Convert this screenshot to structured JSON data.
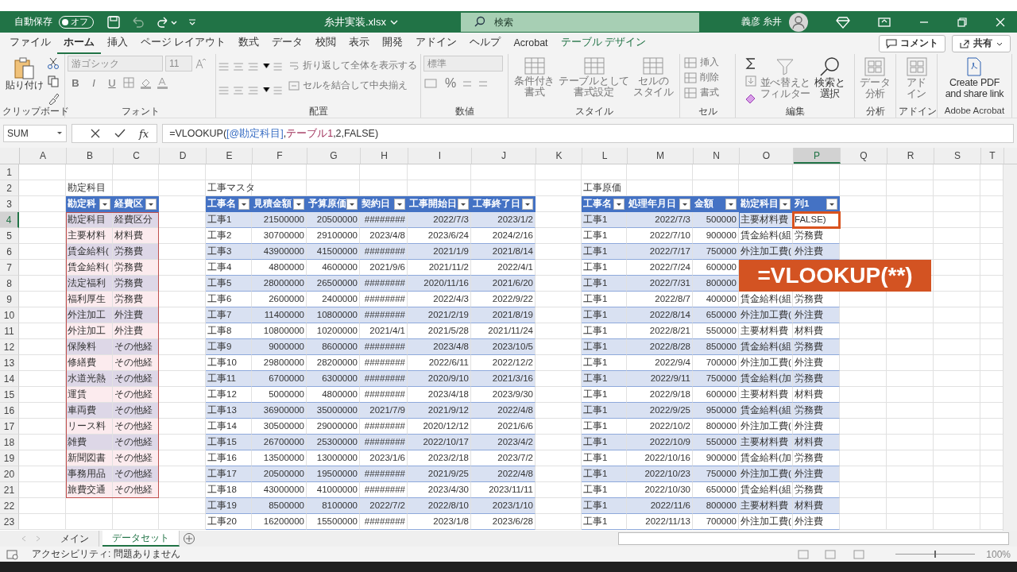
{
  "title_bar": {
    "autosave_label": "自動保存",
    "autosave_toggle": {
      "label": "オフ",
      "on": false
    },
    "filename": "糸井実装.xlsx",
    "search": {
      "placeholder": "検索"
    },
    "user": "義彦 糸井"
  },
  "menu_tabs": [
    {
      "label": "ファイル",
      "selected": false,
      "kind": "normal"
    },
    {
      "label": "ホーム",
      "selected": true,
      "kind": "normal"
    },
    {
      "label": "挿入",
      "selected": false,
      "kind": "normal"
    },
    {
      "label": "ページ レイアウト",
      "selected": false,
      "kind": "normal"
    },
    {
      "label": "数式",
      "selected": false,
      "kind": "normal"
    },
    {
      "label": "データ",
      "selected": false,
      "kind": "normal"
    },
    {
      "label": "校閲",
      "selected": false,
      "kind": "normal"
    },
    {
      "label": "表示",
      "selected": false,
      "kind": "normal"
    },
    {
      "label": "開発",
      "selected": false,
      "kind": "normal"
    },
    {
      "label": "アドイン",
      "selected": false,
      "kind": "normal"
    },
    {
      "label": "ヘルプ",
      "selected": false,
      "kind": "normal"
    },
    {
      "label": "Acrobat",
      "selected": false,
      "kind": "normal"
    },
    {
      "label": "テーブル デザイン",
      "selected": false,
      "kind": "contextual"
    }
  ],
  "header_buttons": [
    {
      "label": "コメント"
    },
    {
      "label": "共有"
    }
  ],
  "ribbon": {
    "groups": [
      {
        "label": "クリップボード",
        "paste": {
          "label": "貼り付け",
          "disabled": false
        }
      },
      {
        "label": "フォント",
        "font_name": {
          "value": "游ゴシック",
          "disabled": true
        },
        "font_size": {
          "value": "11",
          "disabled": true
        },
        "style_buttons": [
          {
            "label": "B",
            "disabled": true
          },
          {
            "label": "I",
            "disabled": true
          },
          {
            "label": "U",
            "disabled": true
          }
        ]
      },
      {
        "label": "配置",
        "wrap": {
          "label": "折り返して全体を表示する",
          "disabled": true
        },
        "merge": {
          "label": "セルを結合して中央揃え",
          "disabled": true
        }
      },
      {
        "label": "数値",
        "format": {
          "value": "標準",
          "disabled": true
        },
        "percent": {
          "label": "%",
          "disabled": true
        }
      },
      {
        "label": "スタイル",
        "buttons": [
          {
            "lines": [
              "条件付き",
              "書式"
            ],
            "disabled": true
          },
          {
            "lines": [
              "テーブルとして",
              "書式設定"
            ],
            "disabled": true
          },
          {
            "lines": [
              "セルの",
              "スタイル"
            ],
            "disabled": true
          }
        ]
      },
      {
        "label": "セル",
        "buttons": [
          {
            "label": "挿入",
            "disabled": true
          },
          {
            "label": "削除",
            "disabled": true
          },
          {
            "label": "書式",
            "disabled": true
          }
        ]
      },
      {
        "label": "編集",
        "buttons": [
          {
            "lines": [
              "並べ替えと",
              "フィルター"
            ],
            "disabled": true
          },
          {
            "lines": [
              "検索と",
              "選択"
            ],
            "disabled": false
          }
        ]
      },
      {
        "label": "分析",
        "buttons": [
          {
            "lines": [
              "データ",
              "分析"
            ],
            "disabled": true
          }
        ]
      },
      {
        "label": "アドイン",
        "buttons": [
          {
            "lines": [
              "アド",
              "イン"
            ],
            "disabled": true
          }
        ]
      },
      {
        "label": "Adobe Acrobat",
        "buttons": [
          {
            "lines": [
              "Create PDF",
              "and share link"
            ],
            "disabled": false
          }
        ]
      }
    ]
  },
  "formula_bar": {
    "name_box": "SUM",
    "fx": "fx",
    "formula": [
      {
        "text": "=VLOOKUP(",
        "kind": "plain"
      },
      {
        "text": "[@勘定科目]",
        "kind": "column"
      },
      {
        "text": ",",
        "kind": "plain"
      },
      {
        "text": "テーブル1",
        "kind": "table"
      },
      {
        "text": ",2,FALSE)",
        "kind": "plain"
      }
    ]
  },
  "sheet": {
    "columns": [
      {
        "letter": "A",
        "selected": false
      },
      {
        "letter": "B",
        "selected": false
      },
      {
        "letter": "C",
        "selected": false
      },
      {
        "letter": "D",
        "selected": false
      },
      {
        "letter": "E",
        "selected": false
      },
      {
        "letter": "F",
        "selected": false
      },
      {
        "letter": "G",
        "selected": false
      },
      {
        "letter": "H",
        "selected": false
      },
      {
        "letter": "I",
        "selected": false
      },
      {
        "letter": "J",
        "selected": false
      },
      {
        "letter": "K",
        "selected": false
      },
      {
        "letter": "L",
        "selected": false
      },
      {
        "letter": "M",
        "selected": false
      },
      {
        "letter": "N",
        "selected": false
      },
      {
        "letter": "O",
        "selected": false
      },
      {
        "letter": "P",
        "selected": true
      },
      {
        "letter": "Q",
        "selected": false
      },
      {
        "letter": "R",
        "selected": false
      },
      {
        "letter": "S",
        "selected": false
      },
      {
        "letter": "T",
        "selected": false
      }
    ],
    "rows": [
      {
        "number": "1",
        "selected": false,
        "cells": {}
      },
      {
        "number": "2",
        "selected": false,
        "cells": {
          "B": {
            "text": "勘定科目",
            "kind": "label"
          },
          "E": {
            "text": "工事マスタ",
            "kind": "label"
          },
          "L": {
            "text": "工事原価",
            "kind": "label"
          }
        }
      },
      {
        "number": "3",
        "selected": false,
        "cells": {
          "B": {
            "text": "勘定科",
            "kind": "header"
          },
          "C": {
            "text": "経費区",
            "kind": "header"
          },
          "E": {
            "text": "工事名",
            "kind": "header"
          },
          "F": {
            "text": "見積金額",
            "kind": "header"
          },
          "G": {
            "text": "予算原価",
            "kind": "header"
          },
          "H": {
            "text": "契約日",
            "kind": "header"
          },
          "I": {
            "text": "工事開始日",
            "kind": "header"
          },
          "J": {
            "text": "工事終了日",
            "kind": "header"
          },
          "L": {
            "text": "工事名",
            "kind": "header"
          },
          "M": {
            "text": "処理年月日",
            "kind": "header"
          },
          "N": {
            "text": "金額",
            "kind": "header"
          },
          "O": {
            "text": "勘定科目",
            "kind": "header"
          },
          "P": {
            "text": "列1",
            "kind": "header"
          }
        }
      },
      {
        "number": "4",
        "selected": true,
        "cells": {
          "B": {
            "text": "勘定科目",
            "kind": "refshaded"
          },
          "C": {
            "text": "経費区分",
            "kind": "refshaded"
          },
          "E": {
            "text": "工事1",
            "kind": "shaded"
          },
          "F": {
            "text": "21500000",
            "kind": "shaded"
          },
          "G": {
            "text": "20500000",
            "kind": "shaded"
          },
          "H": {
            "text": "########",
            "kind": "shaded"
          },
          "I": {
            "text": "2022/7/3",
            "kind": "shaded"
          },
          "J": {
            "text": "2023/1/2",
            "kind": "shaded"
          },
          "L": {
            "text": "工事1",
            "kind": "shaded"
          },
          "M": {
            "text": "2022/7/3",
            "kind": "shaded"
          },
          "N": {
            "text": "500000",
            "kind": "shaded"
          },
          "O": {
            "text": "主要材料費",
            "kind": "refcell"
          },
          "P": {
            "text": "FALSE)",
            "kind": "active"
          }
        }
      },
      {
        "number": "5",
        "selected": false,
        "cells": {
          "B": {
            "text": "主要材料",
            "kind": "refplain"
          },
          "C": {
            "text": "材料費",
            "kind": "refplain"
          },
          "E": {
            "text": "工事2",
            "kind": "plain"
          },
          "F": {
            "text": "30700000",
            "kind": "plain"
          },
          "G": {
            "text": "29100000",
            "kind": "plain"
          },
          "H": {
            "text": "2023/4/8",
            "kind": "plain"
          },
          "I": {
            "text": "2023/6/24",
            "kind": "plain"
          },
          "J": {
            "text": "2024/2/16",
            "kind": "plain"
          },
          "L": {
            "text": "工事1",
            "kind": "plain"
          },
          "M": {
            "text": "2022/7/10",
            "kind": "plain"
          },
          "N": {
            "text": "900000",
            "kind": "plain"
          },
          "O": {
            "text": "賃金給料(組",
            "kind": "plain"
          },
          "P": {
            "text": "労務費",
            "kind": "plain"
          }
        }
      },
      {
        "number": "6",
        "selected": false,
        "cells": {
          "B": {
            "text": "賃金給料(",
            "kind": "refshaded"
          },
          "C": {
            "text": "労務費",
            "kind": "refshaded"
          },
          "E": {
            "text": "工事3",
            "kind": "shaded"
          },
          "F": {
            "text": "43900000",
            "kind": "shaded"
          },
          "G": {
            "text": "41500000",
            "kind": "shaded"
          },
          "H": {
            "text": "########",
            "kind": "shaded"
          },
          "I": {
            "text": "2021/1/9",
            "kind": "shaded"
          },
          "J": {
            "text": "2021/8/14",
            "kind": "shaded"
          },
          "L": {
            "text": "工事1",
            "kind": "shaded"
          },
          "M": {
            "text": "2022/7/17",
            "kind": "shaded"
          },
          "N": {
            "text": "750000",
            "kind": "shaded"
          },
          "O": {
            "text": "外注加工費(",
            "kind": "shaded"
          },
          "P": {
            "text": "外注費",
            "kind": "shaded"
          }
        }
      },
      {
        "number": "7",
        "selected": false,
        "cells": {
          "B": {
            "text": "賃金給料(",
            "kind": "refplain"
          },
          "C": {
            "text": "労務費",
            "kind": "refplain"
          },
          "E": {
            "text": "工事4",
            "kind": "plain"
          },
          "F": {
            "text": "4800000",
            "kind": "plain"
          },
          "G": {
            "text": "4600000",
            "kind": "plain"
          },
          "H": {
            "text": "2021/9/6",
            "kind": "plain"
          },
          "I": {
            "text": "2021/11/2",
            "kind": "plain"
          },
          "J": {
            "text": "2022/4/1",
            "kind": "plain"
          },
          "L": {
            "text": "工事1",
            "kind": "plain"
          },
          "M": {
            "text": "2022/7/24",
            "kind": "plain"
          },
          "N": {
            "text": "600000",
            "kind": "plain"
          }
        }
      },
      {
        "number": "8",
        "selected": false,
        "cells": {
          "B": {
            "text": "法定福利",
            "kind": "refshaded"
          },
          "C": {
            "text": "労務費",
            "kind": "refshaded"
          },
          "E": {
            "text": "工事5",
            "kind": "shaded"
          },
          "F": {
            "text": "28000000",
            "kind": "shaded"
          },
          "G": {
            "text": "26500000",
            "kind": "shaded"
          },
          "H": {
            "text": "########",
            "kind": "shaded"
          },
          "I": {
            "text": "2020/11/16",
            "kind": "shaded"
          },
          "J": {
            "text": "2021/6/20",
            "kind": "shaded"
          },
          "L": {
            "text": "工事1",
            "kind": "shaded"
          },
          "M": {
            "text": "2022/7/31",
            "kind": "shaded"
          },
          "N": {
            "text": "800000",
            "kind": "shaded"
          }
        }
      },
      {
        "number": "9",
        "selected": false,
        "cells": {
          "B": {
            "text": "福利厚生",
            "kind": "refplain"
          },
          "C": {
            "text": "労務費",
            "kind": "refplain"
          },
          "E": {
            "text": "工事6",
            "kind": "plain"
          },
          "F": {
            "text": "2600000",
            "kind": "plain"
          },
          "G": {
            "text": "2400000",
            "kind": "plain"
          },
          "H": {
            "text": "########",
            "kind": "plain"
          },
          "I": {
            "text": "2022/4/3",
            "kind": "plain"
          },
          "J": {
            "text": "2022/9/22",
            "kind": "plain"
          },
          "L": {
            "text": "工事1",
            "kind": "plain"
          },
          "M": {
            "text": "2022/8/7",
            "kind": "plain"
          },
          "N": {
            "text": "400000",
            "kind": "plain"
          },
          "O": {
            "text": "賃金給料(組",
            "kind": "plain"
          },
          "P": {
            "text": "労務費",
            "kind": "plain"
          }
        }
      },
      {
        "number": "10",
        "selected": false,
        "cells": {
          "B": {
            "text": "外注加工",
            "kind": "refshaded"
          },
          "C": {
            "text": "外注費",
            "kind": "refshaded"
          },
          "E": {
            "text": "工事7",
            "kind": "shaded"
          },
          "F": {
            "text": "11400000",
            "kind": "shaded"
          },
          "G": {
            "text": "10800000",
            "kind": "shaded"
          },
          "H": {
            "text": "########",
            "kind": "shaded"
          },
          "I": {
            "text": "2021/2/19",
            "kind": "shaded"
          },
          "J": {
            "text": "2021/8/19",
            "kind": "shaded"
          },
          "L": {
            "text": "工事1",
            "kind": "shaded"
          },
          "M": {
            "text": "2022/8/14",
            "kind": "shaded"
          },
          "N": {
            "text": "650000",
            "kind": "shaded"
          },
          "O": {
            "text": "外注加工費(",
            "kind": "shaded"
          },
          "P": {
            "text": "外注費",
            "kind": "shaded"
          }
        }
      },
      {
        "number": "11",
        "selected": false,
        "cells": {
          "B": {
            "text": "外注加工",
            "kind": "refplain"
          },
          "C": {
            "text": "外注費",
            "kind": "refplain"
          },
          "E": {
            "text": "工事8",
            "kind": "plain"
          },
          "F": {
            "text": "10800000",
            "kind": "plain"
          },
          "G": {
            "text": "10200000",
            "kind": "plain"
          },
          "H": {
            "text": "2021/4/1",
            "kind": "plain"
          },
          "I": {
            "text": "2021/5/28",
            "kind": "plain"
          },
          "J": {
            "text": "2021/11/24",
            "kind": "plain"
          },
          "L": {
            "text": "工事1",
            "kind": "plain"
          },
          "M": {
            "text": "2022/8/21",
            "kind": "plain"
          },
          "N": {
            "text": "550000",
            "kind": "plain"
          },
          "O": {
            "text": "主要材料費",
            "kind": "plain"
          },
          "P": {
            "text": "材料費",
            "kind": "plain"
          }
        }
      },
      {
        "number": "12",
        "selected": false,
        "cells": {
          "B": {
            "text": "保険料",
            "kind": "refshaded"
          },
          "C": {
            "text": "その他経",
            "kind": "refshaded"
          },
          "E": {
            "text": "工事9",
            "kind": "shaded"
          },
          "F": {
            "text": "9000000",
            "kind": "shaded"
          },
          "G": {
            "text": "8600000",
            "kind": "shaded"
          },
          "H": {
            "text": "########",
            "kind": "shaded"
          },
          "I": {
            "text": "2023/4/8",
            "kind": "shaded"
          },
          "J": {
            "text": "2023/10/5",
            "kind": "shaded"
          },
          "L": {
            "text": "工事1",
            "kind": "shaded"
          },
          "M": {
            "text": "2022/8/28",
            "kind": "shaded"
          },
          "N": {
            "text": "850000",
            "kind": "shaded"
          },
          "O": {
            "text": "賃金給料(組",
            "kind": "shaded"
          },
          "P": {
            "text": "労務費",
            "kind": "shaded"
          }
        }
      },
      {
        "number": "13",
        "selected": false,
        "cells": {
          "B": {
            "text": "修繕費",
            "kind": "refplain"
          },
          "C": {
            "text": "その他経",
            "kind": "refplain"
          },
          "E": {
            "text": "工事10",
            "kind": "plain"
          },
          "F": {
            "text": "29800000",
            "kind": "plain"
          },
          "G": {
            "text": "28200000",
            "kind": "plain"
          },
          "H": {
            "text": "########",
            "kind": "plain"
          },
          "I": {
            "text": "2022/6/11",
            "kind": "plain"
          },
          "J": {
            "text": "2022/12/2",
            "kind": "plain"
          },
          "L": {
            "text": "工事1",
            "kind": "plain"
          },
          "M": {
            "text": "2022/9/4",
            "kind": "plain"
          },
          "N": {
            "text": "700000",
            "kind": "plain"
          },
          "O": {
            "text": "外注加工費(",
            "kind": "plain"
          },
          "P": {
            "text": "外注費",
            "kind": "plain"
          }
        }
      },
      {
        "number": "14",
        "selected": false,
        "cells": {
          "B": {
            "text": "水道光熱",
            "kind": "refshaded"
          },
          "C": {
            "text": "その他経",
            "kind": "refshaded"
          },
          "E": {
            "text": "工事11",
            "kind": "shaded"
          },
          "F": {
            "text": "6700000",
            "kind": "shaded"
          },
          "G": {
            "text": "6300000",
            "kind": "shaded"
          },
          "H": {
            "text": "########",
            "kind": "shaded"
          },
          "I": {
            "text": "2020/9/10",
            "kind": "shaded"
          },
          "J": {
            "text": "2021/3/16",
            "kind": "shaded"
          },
          "L": {
            "text": "工事1",
            "kind": "shaded"
          },
          "M": {
            "text": "2022/9/11",
            "kind": "shaded"
          },
          "N": {
            "text": "750000",
            "kind": "shaded"
          },
          "O": {
            "text": "賃金給料(加",
            "kind": "shaded"
          },
          "P": {
            "text": "労務費",
            "kind": "shaded"
          }
        }
      },
      {
        "number": "15",
        "selected": false,
        "cells": {
          "B": {
            "text": "運賃",
            "kind": "refplain"
          },
          "C": {
            "text": "その他経",
            "kind": "refplain"
          },
          "E": {
            "text": "工事12",
            "kind": "plain"
          },
          "F": {
            "text": "5000000",
            "kind": "plain"
          },
          "G": {
            "text": "4800000",
            "kind": "plain"
          },
          "H": {
            "text": "########",
            "kind": "plain"
          },
          "I": {
            "text": "2023/4/18",
            "kind": "plain"
          },
          "J": {
            "text": "2023/9/30",
            "kind": "plain"
          },
          "L": {
            "text": "工事1",
            "kind": "plain"
          },
          "M": {
            "text": "2022/9/18",
            "kind": "plain"
          },
          "N": {
            "text": "600000",
            "kind": "plain"
          },
          "O": {
            "text": "主要材料費",
            "kind": "plain"
          },
          "P": {
            "text": "材料費",
            "kind": "plain"
          }
        }
      },
      {
        "number": "16",
        "selected": false,
        "cells": {
          "B": {
            "text": "車両費",
            "kind": "refshaded"
          },
          "C": {
            "text": "その他経",
            "kind": "refshaded"
          },
          "E": {
            "text": "工事13",
            "kind": "shaded"
          },
          "F": {
            "text": "36900000",
            "kind": "shaded"
          },
          "G": {
            "text": "35000000",
            "kind": "shaded"
          },
          "H": {
            "text": "2021/7/9",
            "kind": "shaded"
          },
          "I": {
            "text": "2021/9/12",
            "kind": "shaded"
          },
          "J": {
            "text": "2022/4/8",
            "kind": "shaded"
          },
          "L": {
            "text": "工事1",
            "kind": "shaded"
          },
          "M": {
            "text": "2022/9/25",
            "kind": "shaded"
          },
          "N": {
            "text": "950000",
            "kind": "shaded"
          },
          "O": {
            "text": "賃金給料(組",
            "kind": "shaded"
          },
          "P": {
            "text": "労務費",
            "kind": "shaded"
          }
        }
      },
      {
        "number": "17",
        "selected": false,
        "cells": {
          "B": {
            "text": "リース料",
            "kind": "refplain"
          },
          "C": {
            "text": "その他経",
            "kind": "refplain"
          },
          "E": {
            "text": "工事14",
            "kind": "plain"
          },
          "F": {
            "text": "30500000",
            "kind": "plain"
          },
          "G": {
            "text": "29000000",
            "kind": "plain"
          },
          "H": {
            "text": "########",
            "kind": "plain"
          },
          "I": {
            "text": "2020/12/12",
            "kind": "plain"
          },
          "J": {
            "text": "2021/6/6",
            "kind": "plain"
          },
          "L": {
            "text": "工事1",
            "kind": "plain"
          },
          "M": {
            "text": "2022/10/2",
            "kind": "plain"
          },
          "N": {
            "text": "800000",
            "kind": "plain"
          },
          "O": {
            "text": "外注加工費(",
            "kind": "plain"
          },
          "P": {
            "text": "外注費",
            "kind": "plain"
          }
        }
      },
      {
        "number": "18",
        "selected": false,
        "cells": {
          "B": {
            "text": "雑費",
            "kind": "refshaded"
          },
          "C": {
            "text": "その他経",
            "kind": "refshaded"
          },
          "E": {
            "text": "工事15",
            "kind": "shaded"
          },
          "F": {
            "text": "26700000",
            "kind": "shaded"
          },
          "G": {
            "text": "25300000",
            "kind": "shaded"
          },
          "H": {
            "text": "########",
            "kind": "shaded"
          },
          "I": {
            "text": "2022/10/17",
            "kind": "shaded"
          },
          "J": {
            "text": "2023/4/2",
            "kind": "shaded"
          },
          "L": {
            "text": "工事1",
            "kind": "shaded"
          },
          "M": {
            "text": "2022/10/9",
            "kind": "shaded"
          },
          "N": {
            "text": "550000",
            "kind": "shaded"
          },
          "O": {
            "text": "主要材料費",
            "kind": "shaded"
          },
          "P": {
            "text": "材料費",
            "kind": "shaded"
          }
        }
      },
      {
        "number": "19",
        "selected": false,
        "cells": {
          "B": {
            "text": "新聞図書",
            "kind": "refplain"
          },
          "C": {
            "text": "その他経",
            "kind": "refplain"
          },
          "E": {
            "text": "工事16",
            "kind": "plain"
          },
          "F": {
            "text": "13500000",
            "kind": "plain"
          },
          "G": {
            "text": "13000000",
            "kind": "plain"
          },
          "H": {
            "text": "2023/1/6",
            "kind": "plain"
          },
          "I": {
            "text": "2023/2/18",
            "kind": "plain"
          },
          "J": {
            "text": "2023/7/2",
            "kind": "plain"
          },
          "L": {
            "text": "工事1",
            "kind": "plain"
          },
          "M": {
            "text": "2022/10/16",
            "kind": "plain"
          },
          "N": {
            "text": "900000",
            "kind": "plain"
          },
          "O": {
            "text": "賃金給料(加",
            "kind": "plain"
          },
          "P": {
            "text": "労務費",
            "kind": "plain"
          }
        }
      },
      {
        "number": "20",
        "selected": false,
        "cells": {
          "B": {
            "text": "事務用品",
            "kind": "refshaded"
          },
          "C": {
            "text": "その他経",
            "kind": "refshaded"
          },
          "E": {
            "text": "工事17",
            "kind": "shaded"
          },
          "F": {
            "text": "20500000",
            "kind": "shaded"
          },
          "G": {
            "text": "19500000",
            "kind": "shaded"
          },
          "H": {
            "text": "########",
            "kind": "shaded"
          },
          "I": {
            "text": "2021/9/25",
            "kind": "shaded"
          },
          "J": {
            "text": "2022/4/8",
            "kind": "shaded"
          },
          "L": {
            "text": "工事1",
            "kind": "shaded"
          },
          "M": {
            "text": "2022/10/23",
            "kind": "shaded"
          },
          "N": {
            "text": "750000",
            "kind": "shaded"
          },
          "O": {
            "text": "外注加工費(",
            "kind": "shaded"
          },
          "P": {
            "text": "外注費",
            "kind": "shaded"
          }
        }
      },
      {
        "number": "21",
        "selected": false,
        "cells": {
          "B": {
            "text": "旅費交通",
            "kind": "refplain"
          },
          "C": {
            "text": "その他経",
            "kind": "refplain"
          },
          "E": {
            "text": "工事18",
            "kind": "plain"
          },
          "F": {
            "text": "43000000",
            "kind": "plain"
          },
          "G": {
            "text": "41000000",
            "kind": "plain"
          },
          "H": {
            "text": "########",
            "kind": "plain"
          },
          "I": {
            "text": "2023/4/30",
            "kind": "plain"
          },
          "J": {
            "text": "2023/11/11",
            "kind": "plain"
          },
          "L": {
            "text": "工事1",
            "kind": "plain"
          },
          "M": {
            "text": "2022/10/30",
            "kind": "plain"
          },
          "N": {
            "text": "650000",
            "kind": "plain"
          },
          "O": {
            "text": "賃金給料(組",
            "kind": "plain"
          },
          "P": {
            "text": "労務費",
            "kind": "plain"
          }
        }
      },
      {
        "number": "22",
        "selected": false,
        "cells": {
          "E": {
            "text": "工事19",
            "kind": "shaded"
          },
          "F": {
            "text": "8500000",
            "kind": "shaded"
          },
          "G": {
            "text": "8100000",
            "kind": "shaded"
          },
          "H": {
            "text": "2022/7/2",
            "kind": "shaded"
          },
          "I": {
            "text": "2022/8/10",
            "kind": "shaded"
          },
          "J": {
            "text": "2023/1/10",
            "kind": "shaded"
          },
          "L": {
            "text": "工事1",
            "kind": "shaded"
          },
          "M": {
            "text": "2022/11/6",
            "kind": "shaded"
          },
          "N": {
            "text": "800000",
            "kind": "shaded"
          },
          "O": {
            "text": "主要材料費",
            "kind": "shaded"
          },
          "P": {
            "text": "材料費",
            "kind": "shaded"
          }
        }
      },
      {
        "number": "23",
        "selected": false,
        "cells": {
          "E": {
            "text": "工事20",
            "kind": "plain"
          },
          "F": {
            "text": "16200000",
            "kind": "plain"
          },
          "G": {
            "text": "15500000",
            "kind": "plain"
          },
          "H": {
            "text": "########",
            "kind": "plain"
          },
          "I": {
            "text": "2023/1/8",
            "kind": "plain"
          },
          "J": {
            "text": "2023/6/28",
            "kind": "plain"
          },
          "L": {
            "text": "工事1",
            "kind": "plain"
          },
          "M": {
            "text": "2022/11/13",
            "kind": "plain"
          },
          "N": {
            "text": "700000",
            "kind": "plain"
          },
          "O": {
            "text": "外注加工費(",
            "kind": "plain"
          },
          "P": {
            "text": "外注費",
            "kind": "plain"
          }
        }
      }
    ]
  },
  "callout": {
    "text": "=VLOOKUP(**)"
  },
  "sheet_tabs": [
    {
      "label": "メイン",
      "selected": false
    },
    {
      "label": "データセット",
      "selected": true
    }
  ],
  "status_bar": {
    "accessibility": "アクセシビリティ: 問題ありません",
    "zoom_slider": {
      "level": 0.5
    },
    "zoom": "100%"
  }
}
